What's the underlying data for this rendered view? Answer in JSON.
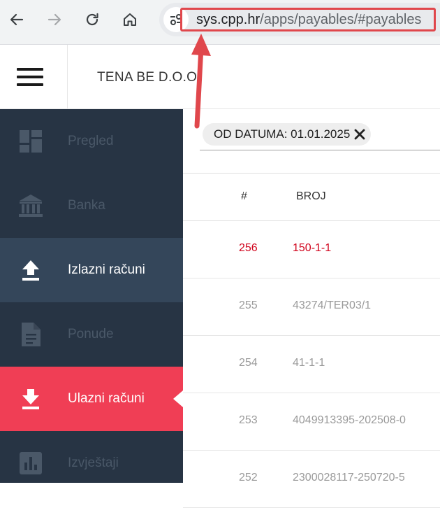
{
  "browser": {
    "url_host": "sys.cpp.hr",
    "url_path": "/apps/payables/#payables",
    "icons": [
      "back-icon",
      "forward-icon",
      "reload-icon",
      "home-icon",
      "site-settings-icon"
    ]
  },
  "header": {
    "company": "TENA BE D.O.O."
  },
  "sidebar": {
    "items": [
      {
        "label": "Pregled",
        "icon": "dashboard-icon"
      },
      {
        "label": "Banka",
        "icon": "bank-icon"
      },
      {
        "label": "Izlazni računi",
        "icon": "upload-icon"
      },
      {
        "label": "Ponude",
        "icon": "document-icon"
      },
      {
        "label": "Ulazni računi",
        "icon": "download-icon"
      },
      {
        "label": "Izvještaji",
        "icon": "chart-icon"
      }
    ]
  },
  "filter": {
    "chip_label": "OD DATUMA: 01.01.2025"
  },
  "table": {
    "columns": [
      "#",
      "BROJ"
    ],
    "rows": [
      {
        "num": "256",
        "broj": "150-1-1"
      },
      {
        "num": "255",
        "broj": "43274/TER03/1"
      },
      {
        "num": "254",
        "broj": "41-1-1"
      },
      {
        "num": "253",
        "broj": "4049913395-202508-0"
      },
      {
        "num": "252",
        "broj": "2300028117-250720-5"
      }
    ]
  },
  "colors": {
    "sidebar_bg": "#273444",
    "active_red": "#f03e55",
    "highlight_text": "#d0021b",
    "annotation": "#e0474c"
  }
}
